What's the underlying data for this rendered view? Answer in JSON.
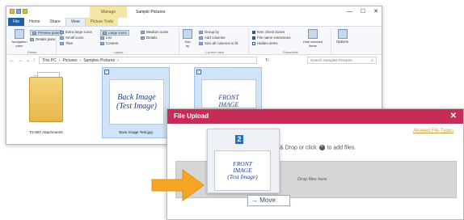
{
  "explorer": {
    "title": "Sample Pictures",
    "manage_tab": "Manage",
    "tabs": [
      "File",
      "Home",
      "Share",
      "View",
      "Picture Tools"
    ],
    "window_controls": [
      "—",
      "☐",
      "✕"
    ],
    "ribbon": {
      "panes": {
        "label": "Panes",
        "navigation_pane": "Navigation pane",
        "preview_pane": "Preview pane",
        "details_pane": "Details pane"
      },
      "layout": {
        "label": "Layout",
        "items": [
          "Extra large icons",
          "Large icons",
          "Medium icons",
          "Small icons",
          "List",
          "Details",
          "Tiles",
          "Content"
        ]
      },
      "current_view": {
        "label": "Current view",
        "sort_by": "Sort by",
        "group_by": "Group by",
        "add_columns": "Add columns",
        "size_all_columns": "Size all columns to fit"
      },
      "show_hide": {
        "label": "Show/hide",
        "item_check_boxes": "Item check boxes",
        "file_name_extensions": "File name extensions",
        "hidden_items": "Hidden items",
        "hide_selected": "Hide selected items"
      },
      "options": "Options"
    },
    "breadcrumb": [
      "This PC",
      "Pictures",
      "Samples Pictures"
    ],
    "search_placeholder": "Search Samples Pictures",
    "files": [
      {
        "name": "TS-897 Attachments"
      },
      {
        "name": "Back Image Test.jpg",
        "thumb_line1": "Back Image",
        "thumb_line2": "(Test Image)"
      },
      {
        "name": "",
        "thumb_line1": "FRONT",
        "thumb_line2": "IMAGE"
      }
    ]
  },
  "upload": {
    "title": "File Upload",
    "close": "✕",
    "allowed_file_types": "Allowed File Types",
    "drag_text_before": "Drag & Drop or click",
    "drag_text_after": "to add files.",
    "drop_text": "Drop files here"
  },
  "drag": {
    "thumb_line1": "FRONT",
    "thumb_line2": "IMAGE",
    "thumb_line3": "(Test Image)",
    "badge": "2",
    "move_label": "Move"
  },
  "colors": {
    "upload_header": "#c62c58",
    "file_tab": "#1f5fa8",
    "selection": "#cfe3fb",
    "arrow": "#f5a623"
  }
}
